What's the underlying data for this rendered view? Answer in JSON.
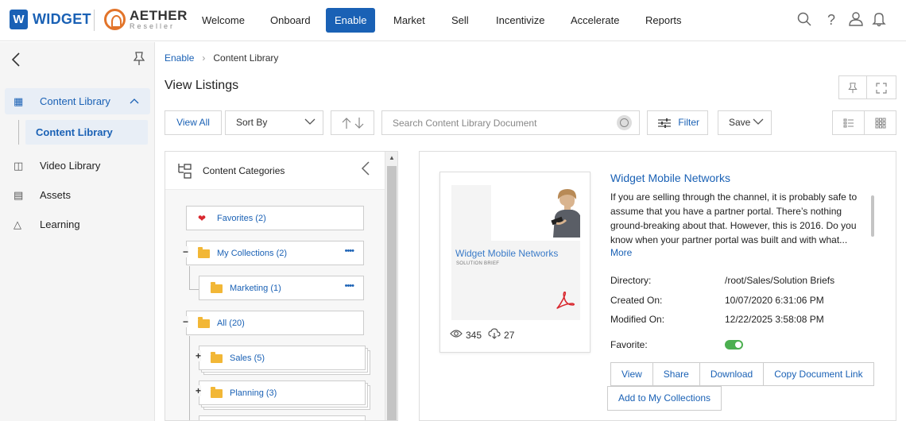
{
  "brand": {
    "logo_letter": "W",
    "logo_name": "WIDGET",
    "partner_title": "AETHER",
    "partner_sub": "Reseller"
  },
  "nav": {
    "items": [
      {
        "label": "Welcome"
      },
      {
        "label": "Onboard"
      },
      {
        "label": "Enable",
        "active": true
      },
      {
        "label": "Market"
      },
      {
        "label": "Sell"
      },
      {
        "label": "Incentivize"
      },
      {
        "label": "Accelerate"
      },
      {
        "label": "Reports"
      }
    ],
    "icons": [
      "search-icon",
      "help-icon",
      "user-icon",
      "notification-bell-icon"
    ]
  },
  "sidebar": {
    "items": [
      {
        "label": "Content Library",
        "icon": "books-icon",
        "expanded": true
      },
      {
        "label": "Video Library",
        "icon": "video-icon"
      },
      {
        "label": "Assets",
        "icon": "briefcase-icon"
      },
      {
        "label": "Learning",
        "icon": "graduation-cap-icon"
      }
    ],
    "sub_item": "Content Library"
  },
  "breadcrumb": {
    "parent": "Enable",
    "current": "Content Library"
  },
  "page": {
    "title": "View Listings"
  },
  "toolbar": {
    "view_all": "View All",
    "sort_by": "Sort By",
    "search_placeholder": "Search Content Library Document",
    "filter": "Filter",
    "save": "Save"
  },
  "categories": {
    "title": "Content Categories",
    "nodes": [
      {
        "label": "Favorites (2)",
        "icon": "heart-icon"
      },
      {
        "label": "My Collections (2)",
        "icon": "folder-open-icon"
      },
      {
        "label": "Marketing (1)",
        "icon": "folder-open-icon"
      },
      {
        "label": "All (20)",
        "icon": "folder-open-icon"
      },
      {
        "label": "Sales (5)",
        "icon": "folder-icon"
      },
      {
        "label": "Planning (3)",
        "icon": "folder-icon"
      }
    ]
  },
  "document": {
    "title": "Widget Mobile Networks",
    "thumb_title": "Widget Mobile Networks",
    "thumb_sub": "SOLUTION BRIEF",
    "description": "If you are selling through the channel, it is probably safe to assume that you have a partner portal. There’s nothing ground-breaking about that. However, this is 2016. Do you know when your partner portal was built and with what...",
    "more": "More",
    "views": "345",
    "downloads": "27",
    "meta": [
      {
        "label": "Directory:",
        "value": "/root/Sales/Solution Briefs"
      },
      {
        "label": "Created On:",
        "value": "10/07/2020 6:31:06 PM"
      },
      {
        "label": "Modified On:",
        "value": "12/22/2025 3:58:08 PM"
      }
    ],
    "favorite_label": "Favorite:",
    "favorite": true,
    "actions": {
      "view": "View",
      "share": "Share",
      "download": "Download",
      "copy_link": "Copy Document Link",
      "add_collection": "Add to My Collections"
    }
  },
  "colors": {
    "accent": "#1a61b5",
    "partner_brand": "#e2742a",
    "toggle_on": "#4caf50",
    "favorite_heart": "#d9282f",
    "folder": "#f2b736"
  }
}
